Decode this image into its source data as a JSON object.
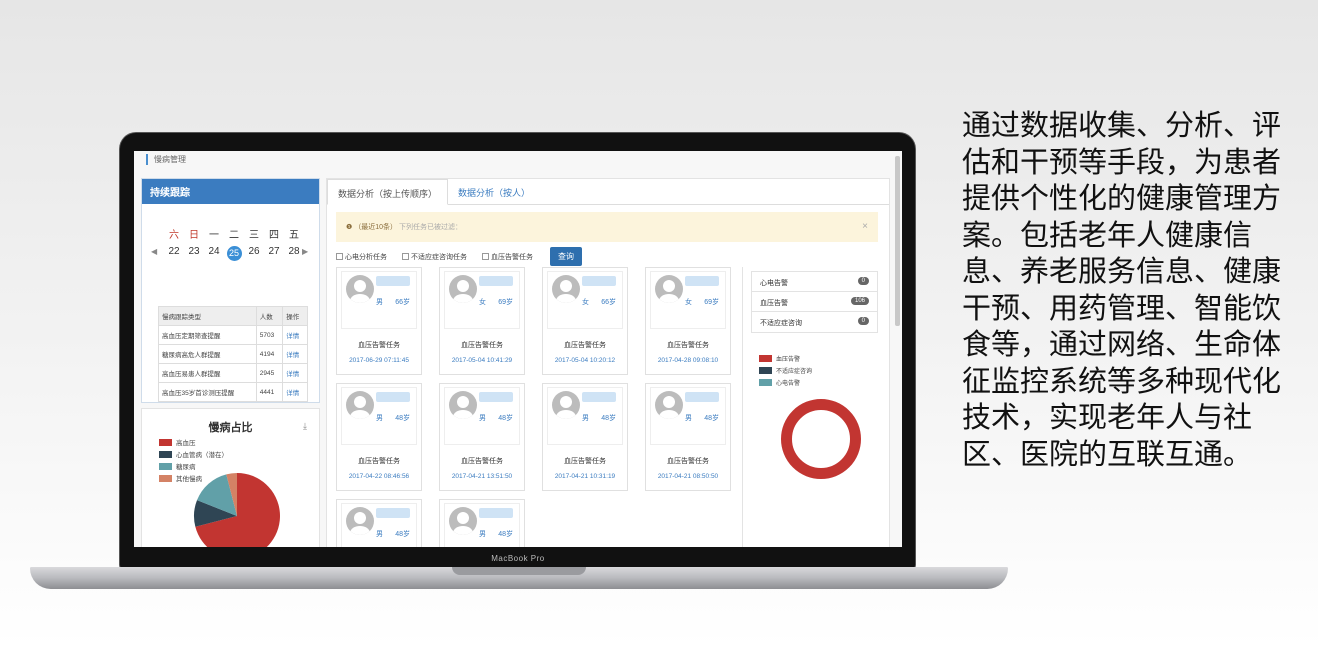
{
  "caption": "通过数据收集、分析、评估和干预等手段，为患者提供个性化的健康管理方案。包括老年人健康信息、养老服务信息、健康干预、用药管理、智能饮食等，通过网络、生命体征监控系统等多种现代化技术，实现老年人与社区、医院的互联互通。",
  "laptop": {
    "label": "MacBook Pro"
  },
  "app": {
    "breadcrumb": "慢病管理",
    "follow_panel": {
      "title": "持续跟踪",
      "weekdays": [
        "六",
        "日",
        "一",
        "二",
        "三",
        "四",
        "五"
      ],
      "days": [
        "22",
        "23",
        "24",
        "25",
        "26",
        "27",
        "28"
      ],
      "today": "25",
      "table": {
        "headers": [
          "慢病跟踪类型",
          "人数",
          "操作"
        ],
        "rows": [
          [
            "高血压定期筛查提醒",
            "5703",
            "详情"
          ],
          [
            "糖尿病高危人群提醒",
            "4194",
            "详情"
          ],
          [
            "高血压易患人群提醒",
            "2945",
            "详情"
          ],
          [
            "高血压35岁首诊测压提醒",
            "4441",
            "详情"
          ]
        ]
      }
    },
    "disease_panel": {
      "title": "慢病占比",
      "legend": [
        {
          "label": "高血压",
          "color": "#c23531"
        },
        {
          "label": "心血管病（潜在）",
          "color": "#2f4554"
        },
        {
          "label": "糖尿病",
          "color": "#61a0a8"
        },
        {
          "label": "其他慢病",
          "color": "#d48265"
        }
      ]
    },
    "chart_data": {
      "type": "pie",
      "title": "慢病占比",
      "categories": [
        "高血压",
        "心血管病（潜在）",
        "糖尿病",
        "其他慢病"
      ],
      "values": [
        71,
        10,
        15,
        4
      ]
    },
    "tabs": [
      "数据分析（按上传顺序）",
      "数据分析（按人）"
    ],
    "alert": {
      "strong": "（最近10条）",
      "text": "下列任务已被过滤：",
      "close": "×"
    },
    "filters": [
      "心电分析任务",
      "不适应症咨询任务",
      "血压告警任务"
    ],
    "query_button": "查询",
    "cards": [
      {
        "sex": "男",
        "age": "66岁",
        "task": "血压告警任务",
        "time": "2017-06-29 07:11:45"
      },
      {
        "sex": "女",
        "age": "69岁",
        "task": "血压告警任务",
        "time": "2017-05-04 10:41:29"
      },
      {
        "sex": "女",
        "age": "66岁",
        "task": "血压告警任务",
        "time": "2017-05-04 10:20:12"
      },
      {
        "sex": "女",
        "age": "69岁",
        "task": "血压告警任务",
        "time": "2017-04-28 09:08:10"
      },
      {
        "sex": "男",
        "age": "48岁",
        "task": "血压告警任务",
        "time": "2017-04-22 08:46:56"
      },
      {
        "sex": "男",
        "age": "48岁",
        "task": "血压告警任务",
        "time": "2017-04-21 13:51:50"
      },
      {
        "sex": "男",
        "age": "48岁",
        "task": "血压告警任务",
        "time": "2017-04-21 10:31:19"
      },
      {
        "sex": "男",
        "age": "48岁",
        "task": "血压告警任务",
        "time": "2017-04-21 08:50:50"
      },
      {
        "sex": "男",
        "age": "48岁",
        "task": "",
        "time": ""
      },
      {
        "sex": "男",
        "age": "48岁",
        "task": "",
        "time": ""
      }
    ],
    "stats": [
      {
        "label": "心电告警",
        "count": "0"
      },
      {
        "label": "血压告警",
        "count": "106"
      },
      {
        "label": "不适应症咨询",
        "count": "0"
      }
    ],
    "ring_legend": [
      {
        "label": "血压告警",
        "color": "#c23531"
      },
      {
        "label": "不适应症咨询",
        "color": "#2f4554"
      },
      {
        "label": "心电告警",
        "color": "#61a0a8"
      }
    ],
    "ring_chart": {
      "type": "pie",
      "categories": [
        "血压告警",
        "不适应症咨询",
        "心电告警"
      ],
      "values": [
        106,
        0,
        0
      ]
    }
  }
}
